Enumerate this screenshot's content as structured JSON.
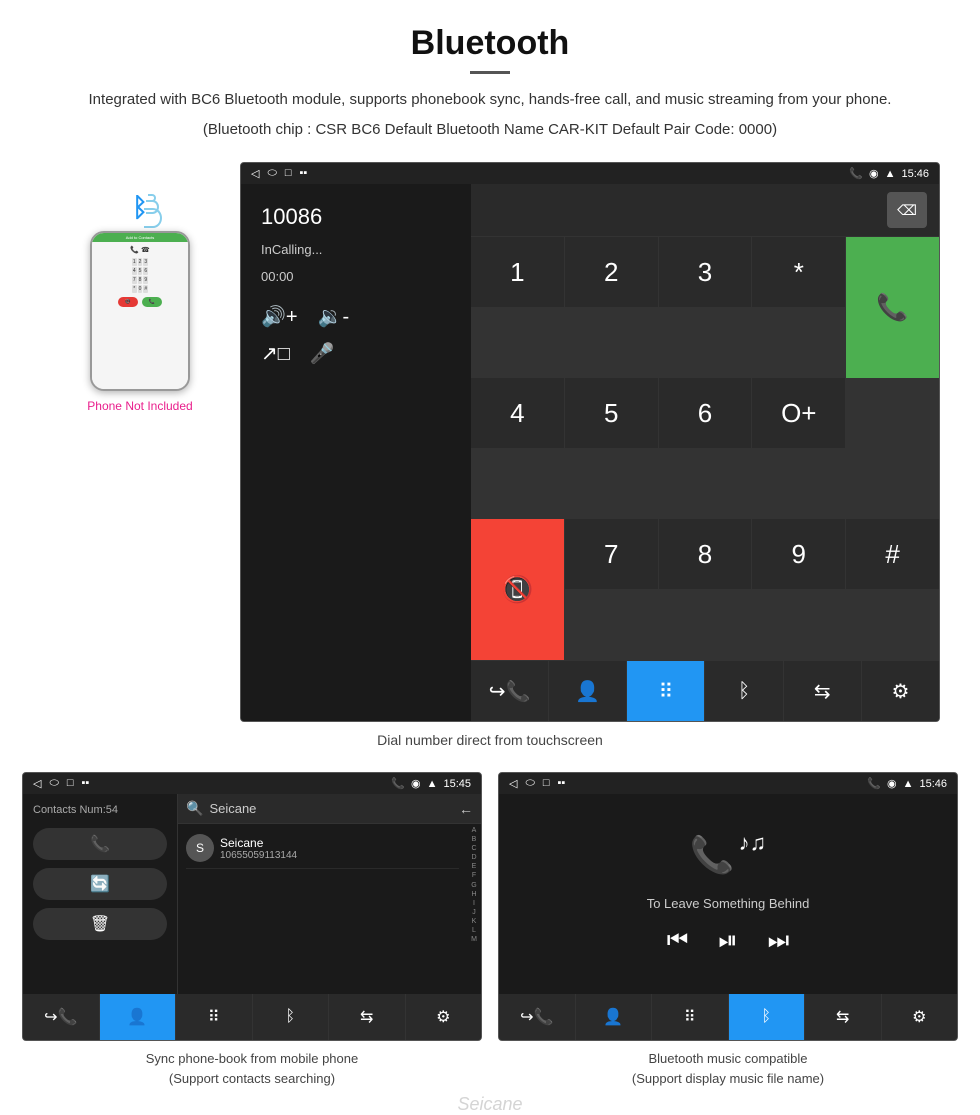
{
  "page": {
    "title": "Bluetooth",
    "description": "Integrated with BC6 Bluetooth module, supports phonebook sync, hands-free call, and music streaming from your phone.",
    "info_line": "(Bluetooth chip : CSR BC6    Default Bluetooth Name CAR-KIT    Default Pair Code: 0000)",
    "phone_not_included": "Phone Not Included",
    "dial_caption": "Dial number direct from touchscreen",
    "contacts_caption": "Sync phone-book from mobile phone\n(Support contacts searching)",
    "music_caption": "Bluetooth music compatible\n(Support display music file name)"
  },
  "dialer": {
    "number_display": "10086",
    "status": "InCalling...",
    "timer": "00:00",
    "status_bar_time": "15:46",
    "keys": [
      "1",
      "2",
      "3",
      "*",
      "4",
      "5",
      "6",
      "O+",
      "7",
      "8",
      "9",
      "#"
    ],
    "backspace_label": "⌫"
  },
  "contacts": {
    "contacts_num": "Contacts Num:54",
    "search_placeholder": "Seicane",
    "contact_number_display": "10655059113144",
    "status_bar_time": "15:45",
    "alphabet": [
      "A",
      "B",
      "C",
      "D",
      "E",
      "F",
      "G",
      "H",
      "I",
      "J",
      "K",
      "L",
      "M"
    ]
  },
  "music": {
    "song_title": "To Leave Something Behind",
    "status_bar_time": "15:46"
  },
  "toolbar": {
    "items": [
      "call-fwd",
      "contacts",
      "keypad",
      "bluetooth",
      "transfer",
      "settings"
    ]
  }
}
